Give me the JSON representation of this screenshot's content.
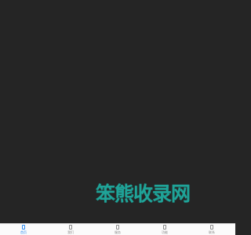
{
  "watermark": {
    "text": "笨熊收录网",
    "color": "#1fa398"
  },
  "tabbar": {
    "active_color": "#2d8cf0",
    "inactive_color": "#8a8a8a",
    "items": [
      {
        "label": "首页",
        "icon": "phone-icon",
        "active": true
      },
      {
        "label": "我们",
        "icon": "phone-icon",
        "active": false
      },
      {
        "label": "服务",
        "icon": "phone-icon",
        "active": false
      },
      {
        "label": "功能",
        "icon": "phone-icon",
        "active": false
      },
      {
        "label": "联系",
        "icon": "phone-icon",
        "active": false
      }
    ]
  }
}
